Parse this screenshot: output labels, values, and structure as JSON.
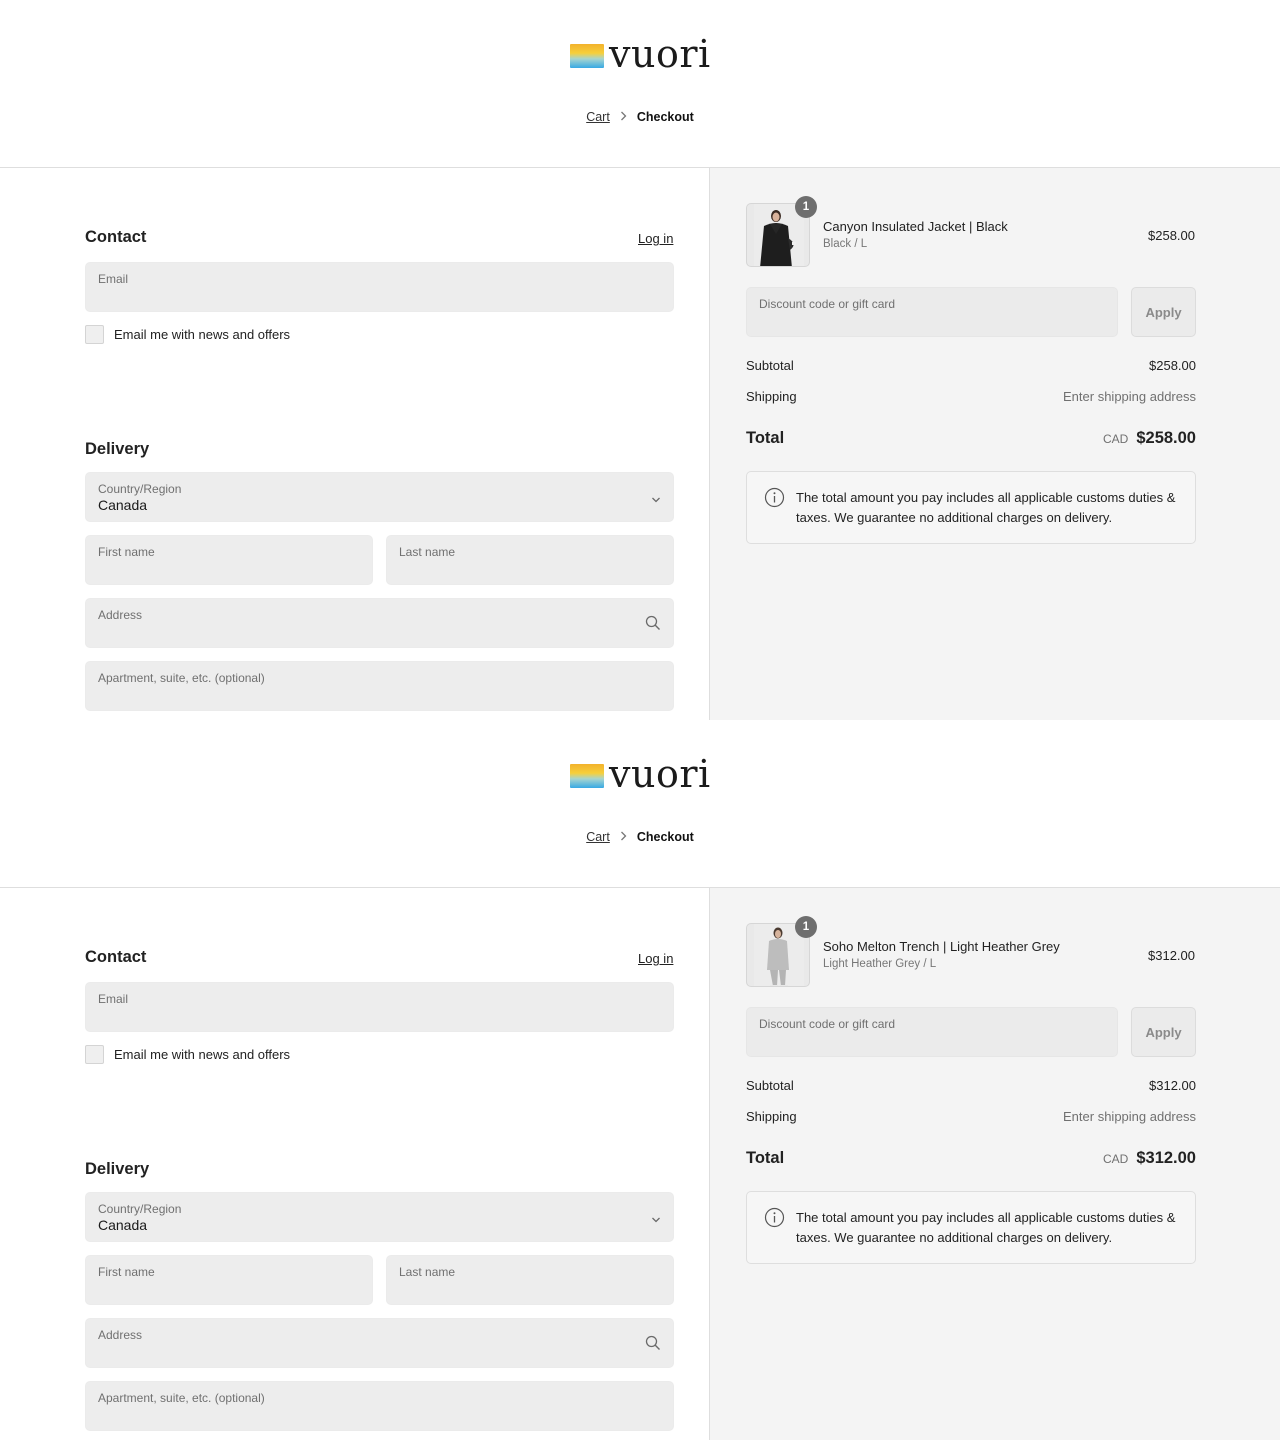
{
  "brand": {
    "name": "vuori"
  },
  "panels": [
    {
      "breadcrumb": {
        "cart": "Cart",
        "current": "Checkout"
      },
      "contact": {
        "title": "Contact",
        "login": "Log in",
        "email_label": "Email",
        "newsletter_label": "Email me with news and offers"
      },
      "delivery": {
        "title": "Delivery",
        "country_label": "Country/Region",
        "country_value": "Canada",
        "first_name_label": "First name",
        "last_name_label": "Last name",
        "address_label": "Address",
        "apartment_label": "Apartment, suite, etc. (optional)"
      },
      "order": {
        "item": {
          "quantity": "1",
          "name": "Canyon Insulated Jacket | Black",
          "variant": "Black / L",
          "price": "$258.00"
        },
        "discount_label": "Discount code or gift card",
        "apply": "Apply",
        "subtotal_label": "Subtotal",
        "subtotal_value": "$258.00",
        "shipping_label": "Shipping",
        "shipping_value": "Enter shipping address",
        "total_label": "Total",
        "currency": "CAD",
        "total_value": "$258.00",
        "notice": "The total amount you pay includes all applicable customs duties & taxes. We guarantee no additional charges on delivery."
      }
    },
    {
      "breadcrumb": {
        "cart": "Cart",
        "current": "Checkout"
      },
      "contact": {
        "title": "Contact",
        "login": "Log in",
        "email_label": "Email",
        "newsletter_label": "Email me with news and offers"
      },
      "delivery": {
        "title": "Delivery",
        "country_label": "Country/Region",
        "country_value": "Canada",
        "first_name_label": "First name",
        "last_name_label": "Last name",
        "address_label": "Address",
        "apartment_label": "Apartment, suite, etc. (optional)"
      },
      "order": {
        "item": {
          "quantity": "1",
          "name": "Soho Melton Trench | Light Heather Grey",
          "variant": "Light Heather Grey / L",
          "price": "$312.00"
        },
        "discount_label": "Discount code or gift card",
        "apply": "Apply",
        "subtotal_label": "Subtotal",
        "subtotal_value": "$312.00",
        "shipping_label": "Shipping",
        "shipping_value": "Enter shipping address",
        "total_label": "Total",
        "currency": "CAD",
        "total_value": "$312.00",
        "notice": "The total amount you pay includes all applicable customs duties & taxes. We guarantee no additional charges on delivery."
      }
    }
  ]
}
